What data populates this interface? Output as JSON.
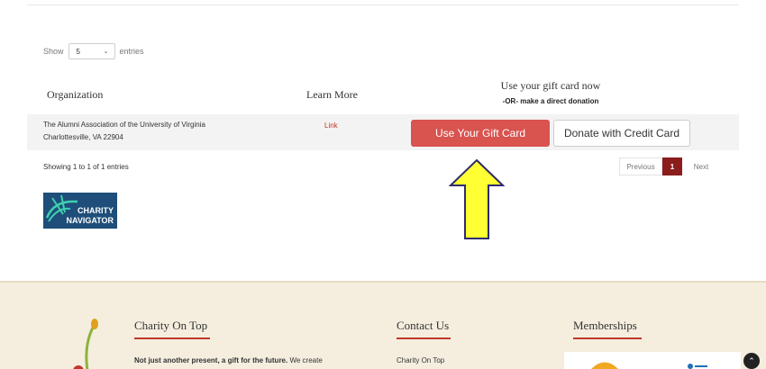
{
  "show_entries": {
    "show_label": "Show",
    "selected": "5",
    "entries_label": "entries"
  },
  "table": {
    "headers": {
      "organization": "Organization",
      "learn_more": "Learn More",
      "gift_card": "Use your gift card now",
      "or_text": "-OR- make a direct donation"
    },
    "rows": [
      {
        "org_name": "The Alumni Association of the University of Virginia",
        "org_address": "Charlottesville, VA 22904",
        "link_text": "Link",
        "gift_button": "Use Your Gift Card",
        "credit_button": "Donate with Credit Card"
      }
    ]
  },
  "info": "Showing 1 to 1 of 1 entries",
  "pagination": {
    "previous": "Previous",
    "current": "1",
    "next": "Next"
  },
  "charity_navigator": {
    "line1": "CHARITY",
    "line2": "NAVIGATOR"
  },
  "footer": {
    "col1": {
      "heading": "Charity On Top",
      "text_bold": "Not just another present, a gift for the future.",
      "text_rest": " We create"
    },
    "col2": {
      "heading": "Contact Us",
      "text": "Charity On Top"
    },
    "col3": {
      "heading": "Memberships"
    }
  },
  "colors": {
    "accent_red": "#d9534f",
    "pager_active": "#8b1d1d",
    "footer_bg": "#f5eedf",
    "arrow_fill": "#ffff33"
  },
  "icons": {
    "arrow": "up-arrow-annotation",
    "scroll": "chevron-up-icon"
  }
}
